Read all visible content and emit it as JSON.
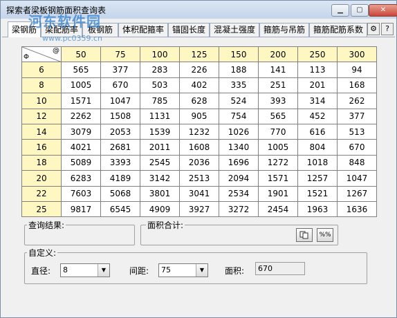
{
  "window": {
    "title": "探索者梁板钢筋面积查询表"
  },
  "watermark": {
    "text": "河东软件园",
    "url": "www.pc0359.cn"
  },
  "tabs": [
    {
      "label": "梁钢筋"
    },
    {
      "label": "梁配筋率"
    },
    {
      "label": "板钢筋"
    },
    {
      "label": "体积配箍率"
    },
    {
      "label": "锚固长度"
    },
    {
      "label": "混凝土强度"
    },
    {
      "label": "箍筋与吊筋"
    },
    {
      "label": "箍筋配筋系数"
    }
  ],
  "table": {
    "corner_row": "Φ",
    "corner_col": "@",
    "spacings": [
      "50",
      "75",
      "100",
      "125",
      "150",
      "200",
      "250",
      "300"
    ],
    "rows": [
      {
        "d": "6",
        "v": [
          "565",
          "377",
          "283",
          "226",
          "188",
          "141",
          "113",
          "94"
        ]
      },
      {
        "d": "8",
        "v": [
          "1005",
          "670",
          "503",
          "402",
          "335",
          "251",
          "201",
          "168"
        ]
      },
      {
        "d": "10",
        "v": [
          "1571",
          "1047",
          "785",
          "628",
          "524",
          "393",
          "314",
          "262"
        ]
      },
      {
        "d": "12",
        "v": [
          "2262",
          "1508",
          "1131",
          "905",
          "754",
          "565",
          "452",
          "377"
        ]
      },
      {
        "d": "14",
        "v": [
          "3079",
          "2053",
          "1539",
          "1232",
          "1026",
          "770",
          "616",
          "513"
        ]
      },
      {
        "d": "16",
        "v": [
          "4021",
          "2681",
          "2011",
          "1608",
          "1340",
          "1005",
          "804",
          "670"
        ]
      },
      {
        "d": "18",
        "v": [
          "5089",
          "3393",
          "2545",
          "2036",
          "1696",
          "1272",
          "1018",
          "848"
        ]
      },
      {
        "d": "20",
        "v": [
          "6283",
          "4189",
          "3142",
          "2513",
          "2094",
          "1571",
          "1257",
          "1047"
        ]
      },
      {
        "d": "22",
        "v": [
          "7603",
          "5068",
          "3801",
          "3041",
          "2534",
          "1901",
          "1521",
          "1267"
        ]
      },
      {
        "d": "25",
        "v": [
          "9817",
          "6545",
          "4909",
          "3927",
          "3272",
          "2454",
          "1963",
          "1636"
        ]
      }
    ]
  },
  "query": {
    "label": "查询结果:"
  },
  "area_sum": {
    "label": "面积合计:",
    "btn2": "%%"
  },
  "custom": {
    "label": "自定义:",
    "diameter_label": "直径:",
    "diameter_value": "8",
    "spacing_label": "间距:",
    "spacing_value": "75",
    "area_label": "面积:",
    "area_value": "670"
  }
}
